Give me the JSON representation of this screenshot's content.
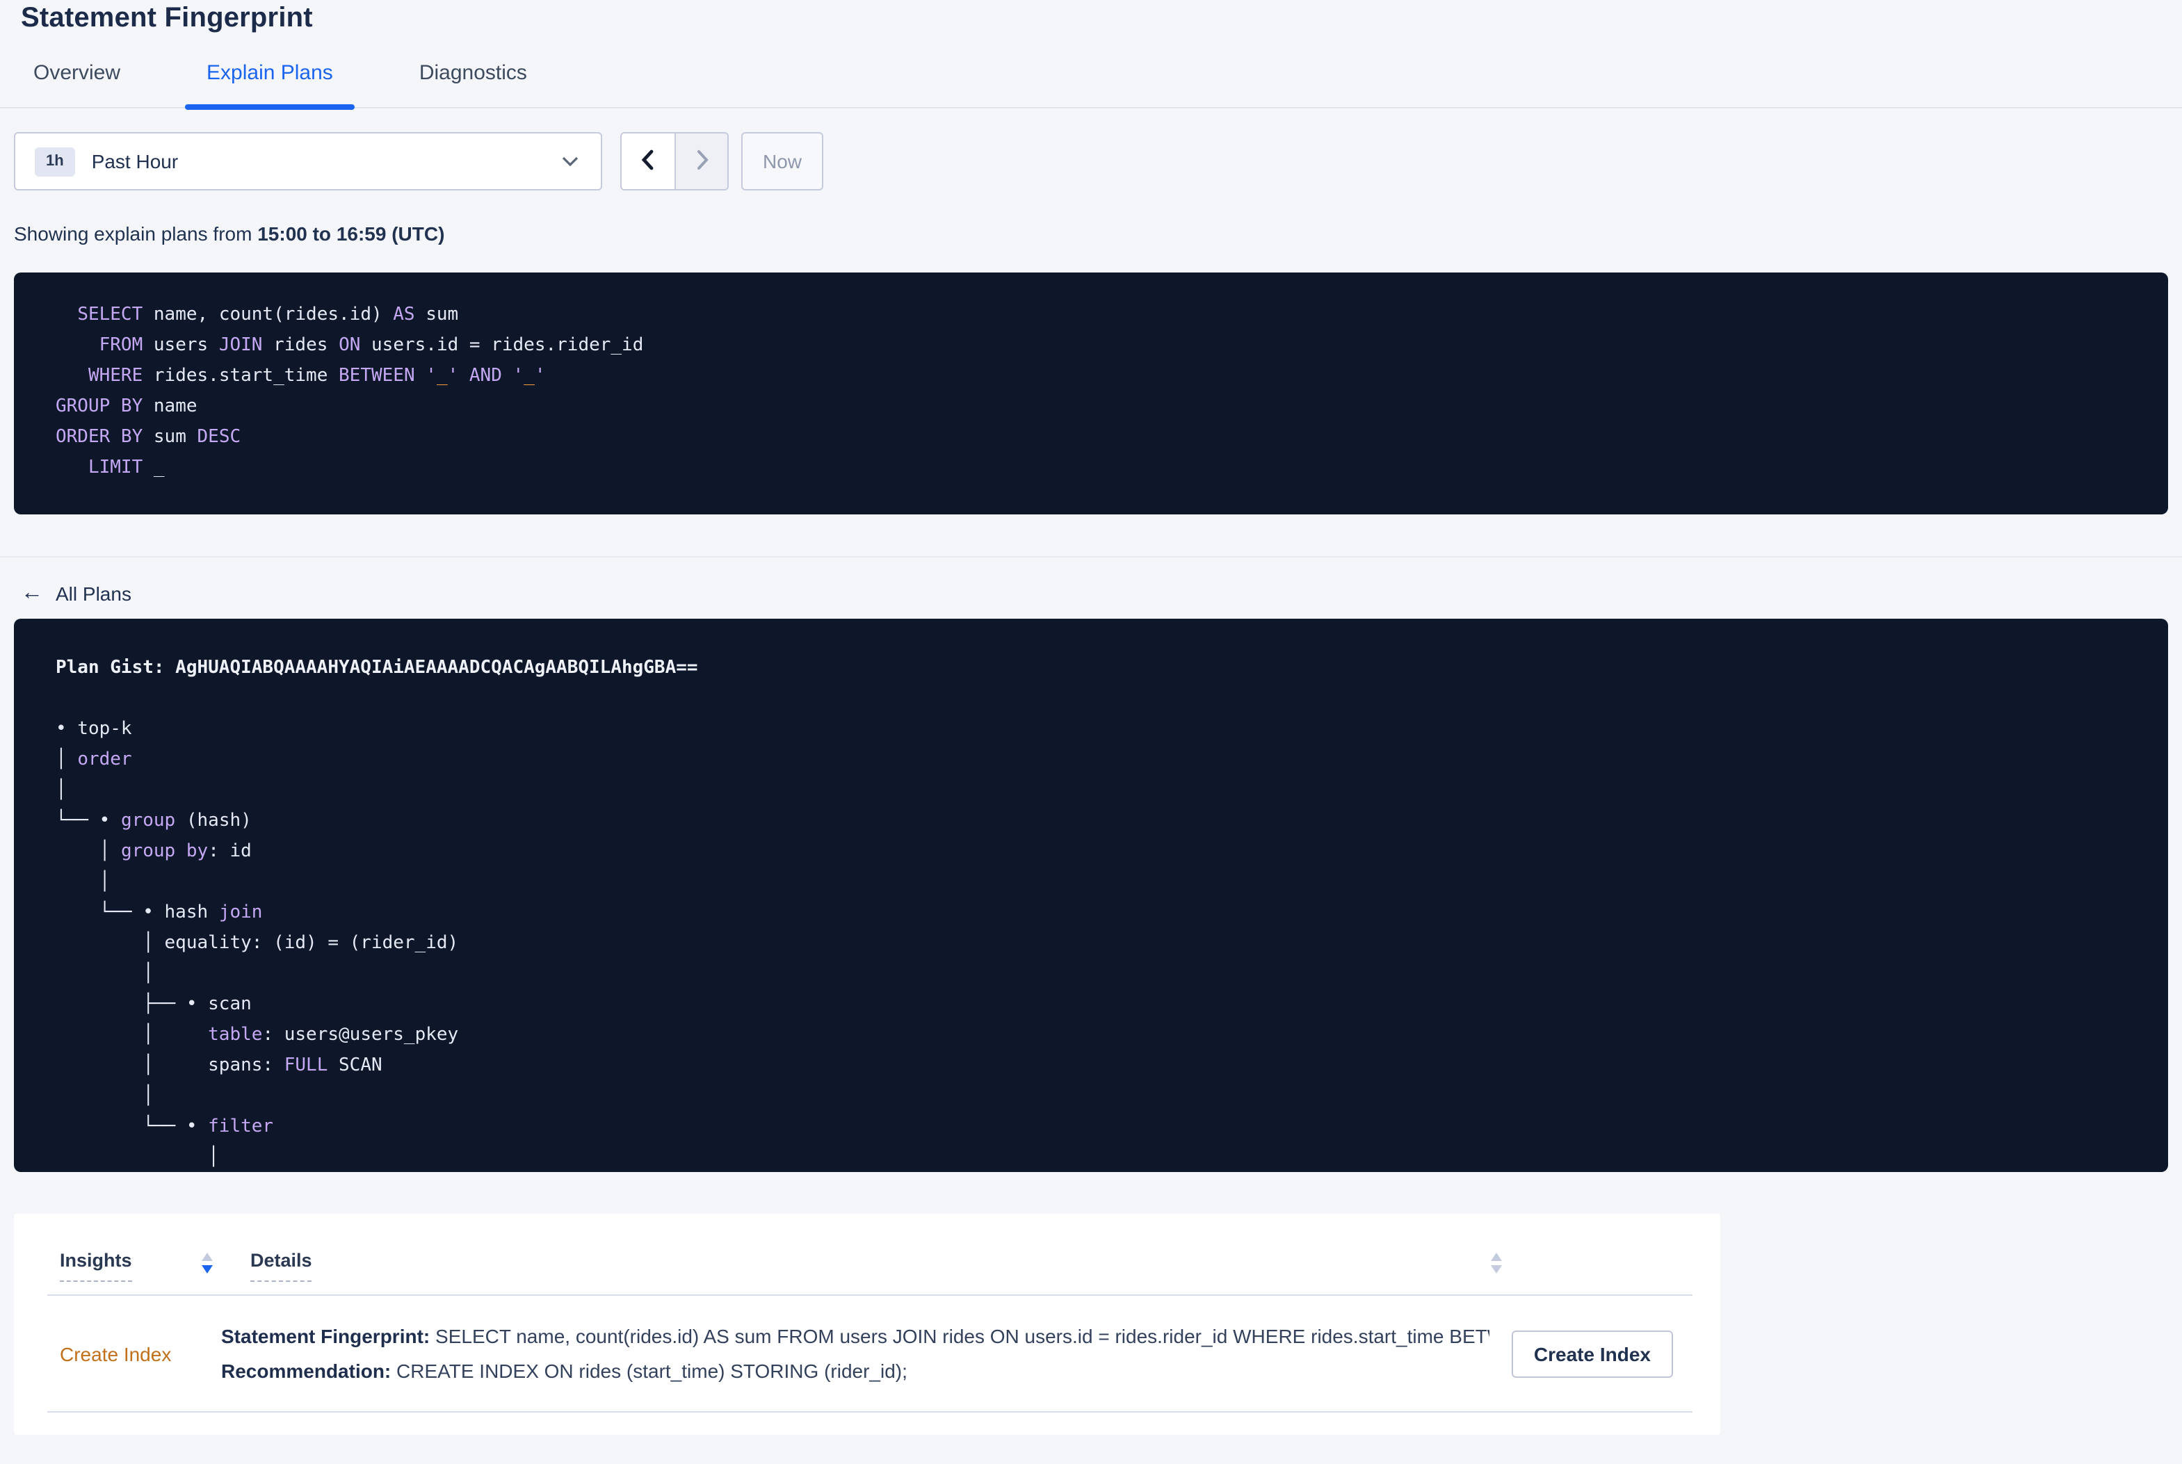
{
  "page": {
    "title": "Statement Fingerprint"
  },
  "tabs": [
    {
      "label": "Overview",
      "active": false
    },
    {
      "label": "Explain Plans",
      "active": true
    },
    {
      "label": "Diagnostics",
      "active": false
    }
  ],
  "time_picker": {
    "interval_badge": "1h",
    "selected": "Past Hour",
    "now_label": "Now",
    "prev_icon": "chevron-left-icon",
    "next_icon": "chevron-right-icon"
  },
  "status_line": {
    "prefix": "Showing explain plans from ",
    "bold_range": "15:00 to 16:59 (UTC)"
  },
  "sql_block": {
    "lines": [
      [
        [
          "p",
          "  "
        ],
        [
          "k",
          "SELECT"
        ],
        [
          "p",
          " name, count(rides.id) "
        ],
        [
          "k",
          "AS"
        ],
        [
          "p",
          " sum"
        ]
      ],
      [
        [
          "p",
          "    "
        ],
        [
          "k",
          "FROM"
        ],
        [
          "p",
          " users "
        ],
        [
          "k",
          "JOIN"
        ],
        [
          "p",
          " rides "
        ],
        [
          "k",
          "ON"
        ],
        [
          "p",
          " users.id = rides.rider_id"
        ]
      ],
      [
        [
          "p",
          "   "
        ],
        [
          "k",
          "WHERE"
        ],
        [
          "p",
          " rides.start_time "
        ],
        [
          "k",
          "BETWEEN"
        ],
        [
          "p",
          " "
        ],
        [
          "q",
          "'"
        ],
        [
          "o",
          "_"
        ],
        [
          "q",
          "'"
        ],
        [
          "p",
          " "
        ],
        [
          "k",
          "AND"
        ],
        [
          "p",
          " "
        ],
        [
          "q",
          "'"
        ],
        [
          "o",
          "_"
        ],
        [
          "q",
          "'"
        ]
      ],
      [
        [
          "k",
          "GROUP BY"
        ],
        [
          "p",
          " name"
        ]
      ],
      [
        [
          "k",
          "ORDER BY"
        ],
        [
          "p",
          " sum "
        ],
        [
          "k",
          "DESC"
        ]
      ],
      [
        [
          "p",
          "   "
        ],
        [
          "k",
          "LIMIT"
        ],
        [
          "p",
          " _"
        ]
      ]
    ]
  },
  "back_link": {
    "label": "All Plans"
  },
  "plan_block": {
    "gist_label": "Plan Gist:",
    "gist": "AgHUAQIABQAAAAHYAQIAiAEAAAADCQACAgAABQILAhgGBA==",
    "lines": [
      [
        [
          "b",
          "Plan Gist: AgHUAQIABQAAAAHYAQIAiAEAAAADCQACAgAABQILAhgGBA=="
        ]
      ],
      [],
      [
        [
          "p",
          "• top-k"
        ]
      ],
      [
        [
          "p",
          "│ "
        ],
        [
          "k",
          "order"
        ]
      ],
      [
        [
          "p",
          "│"
        ]
      ],
      [
        [
          "p",
          "└── • "
        ],
        [
          "k",
          "group"
        ],
        [
          "p",
          " (hash)"
        ]
      ],
      [
        [
          "p",
          "    │ "
        ],
        [
          "k",
          "group by"
        ],
        [
          "p",
          ": id"
        ]
      ],
      [
        [
          "p",
          "    │"
        ]
      ],
      [
        [
          "p",
          "    └── • hash "
        ],
        [
          "k",
          "join"
        ]
      ],
      [
        [
          "p",
          "        │ equality: (id) = (rider_id)"
        ]
      ],
      [
        [
          "p",
          "        │"
        ]
      ],
      [
        [
          "p",
          "        ├── • scan"
        ]
      ],
      [
        [
          "p",
          "        │     "
        ],
        [
          "k",
          "table"
        ],
        [
          "p",
          ": users@users_pkey"
        ]
      ],
      [
        [
          "p",
          "        │     spans: "
        ],
        [
          "k",
          "FULL"
        ],
        [
          "p",
          " SCAN"
        ]
      ],
      [
        [
          "p",
          "        │"
        ]
      ],
      [
        [
          "p",
          "        └── • "
        ],
        [
          "k",
          "filter"
        ]
      ],
      [
        [
          "p",
          "              │"
        ]
      ]
    ]
  },
  "insights_table": {
    "columns": [
      {
        "label": "Insights"
      },
      {
        "label": "Details"
      }
    ],
    "rows": [
      {
        "insight": "Create Index",
        "details": [
          {
            "label": "Statement Fingerprint:",
            "text": " SELECT name, count(rides.id) AS sum FROM users JOIN rides ON users.id = rides.rider_id WHERE rides.start_time BETWEEN '_…"
          },
          {
            "label": "Recommendation:",
            "text": " CREATE INDEX ON rides (start_time) STORING (rider_id);"
          }
        ],
        "action_label": "Create Index"
      }
    ]
  },
  "colors": {
    "accent_blue": "#1a64f0",
    "insight_orange": "#c2701a",
    "code_background": "#0e1729",
    "code_keyword": "#c5a8f3",
    "code_literal": "#ff9e3d",
    "page_background": "#f4f6fa"
  }
}
